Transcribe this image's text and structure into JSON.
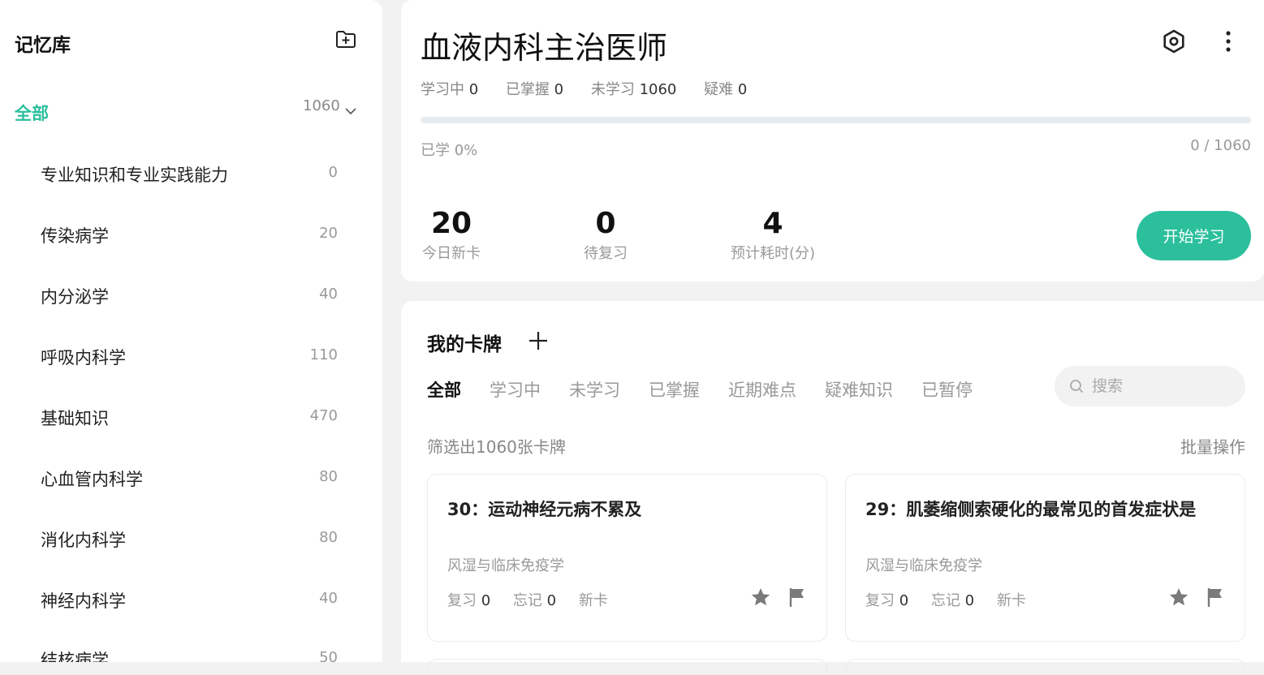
{
  "sidebar": {
    "title": "记忆库",
    "all": {
      "label": "全部",
      "count": "1060"
    },
    "items": [
      {
        "label": "专业知识和专业实践能力",
        "count": "0"
      },
      {
        "label": "传染病学",
        "count": "20"
      },
      {
        "label": "内分泌学",
        "count": "40"
      },
      {
        "label": "呼吸内科学",
        "count": "110"
      },
      {
        "label": "基础知识",
        "count": "470"
      },
      {
        "label": "心血管内科学",
        "count": "80"
      },
      {
        "label": "消化内科学",
        "count": "80"
      },
      {
        "label": "神经内科学",
        "count": "40"
      },
      {
        "label": "结核病学",
        "count": "50"
      }
    ]
  },
  "header": {
    "title": "血液内科主治医师",
    "stats": {
      "learning_label": "学习中",
      "learning": "0",
      "mastered_label": "已掌握",
      "mastered": "0",
      "unlearned_label": "未学习",
      "unlearned": "1060",
      "difficult_label": "疑难",
      "difficult": "0"
    },
    "progress": {
      "fraction": 0,
      "label": "已学 0%",
      "count": "0 / 1060"
    },
    "metrics": [
      {
        "num": "20",
        "label": "今日新卡"
      },
      {
        "num": "0",
        "label": "待复习"
      },
      {
        "num": "4",
        "label": "预计耗时(分)"
      }
    ],
    "start_label": "开始学习"
  },
  "cards_panel": {
    "title": "我的卡牌",
    "tabs": [
      "全部",
      "学习中",
      "未学习",
      "已掌握",
      "近期难点",
      "疑难知识",
      "已暂停"
    ],
    "search_placeholder": "搜索",
    "filter_info": "筛选出1060张卡牌",
    "batch_label": "批量操作",
    "cards": [
      {
        "title": "30：运动神经元病不累及",
        "category": "风湿与临床免疫学",
        "review_label": "复习",
        "review": "0",
        "forget_label": "忘记",
        "forget": "0",
        "status": "新卡"
      },
      {
        "title": "29：肌萎缩侧索硬化的最常见的首发症状是",
        "category": "风湿与临床免疫学",
        "review_label": "复习",
        "review": "0",
        "forget_label": "忘记",
        "forget": "0",
        "status": "新卡"
      }
    ]
  },
  "colors": {
    "accent": "#2bbf9c",
    "muted": "#999999",
    "background": "#f2f2f2"
  }
}
